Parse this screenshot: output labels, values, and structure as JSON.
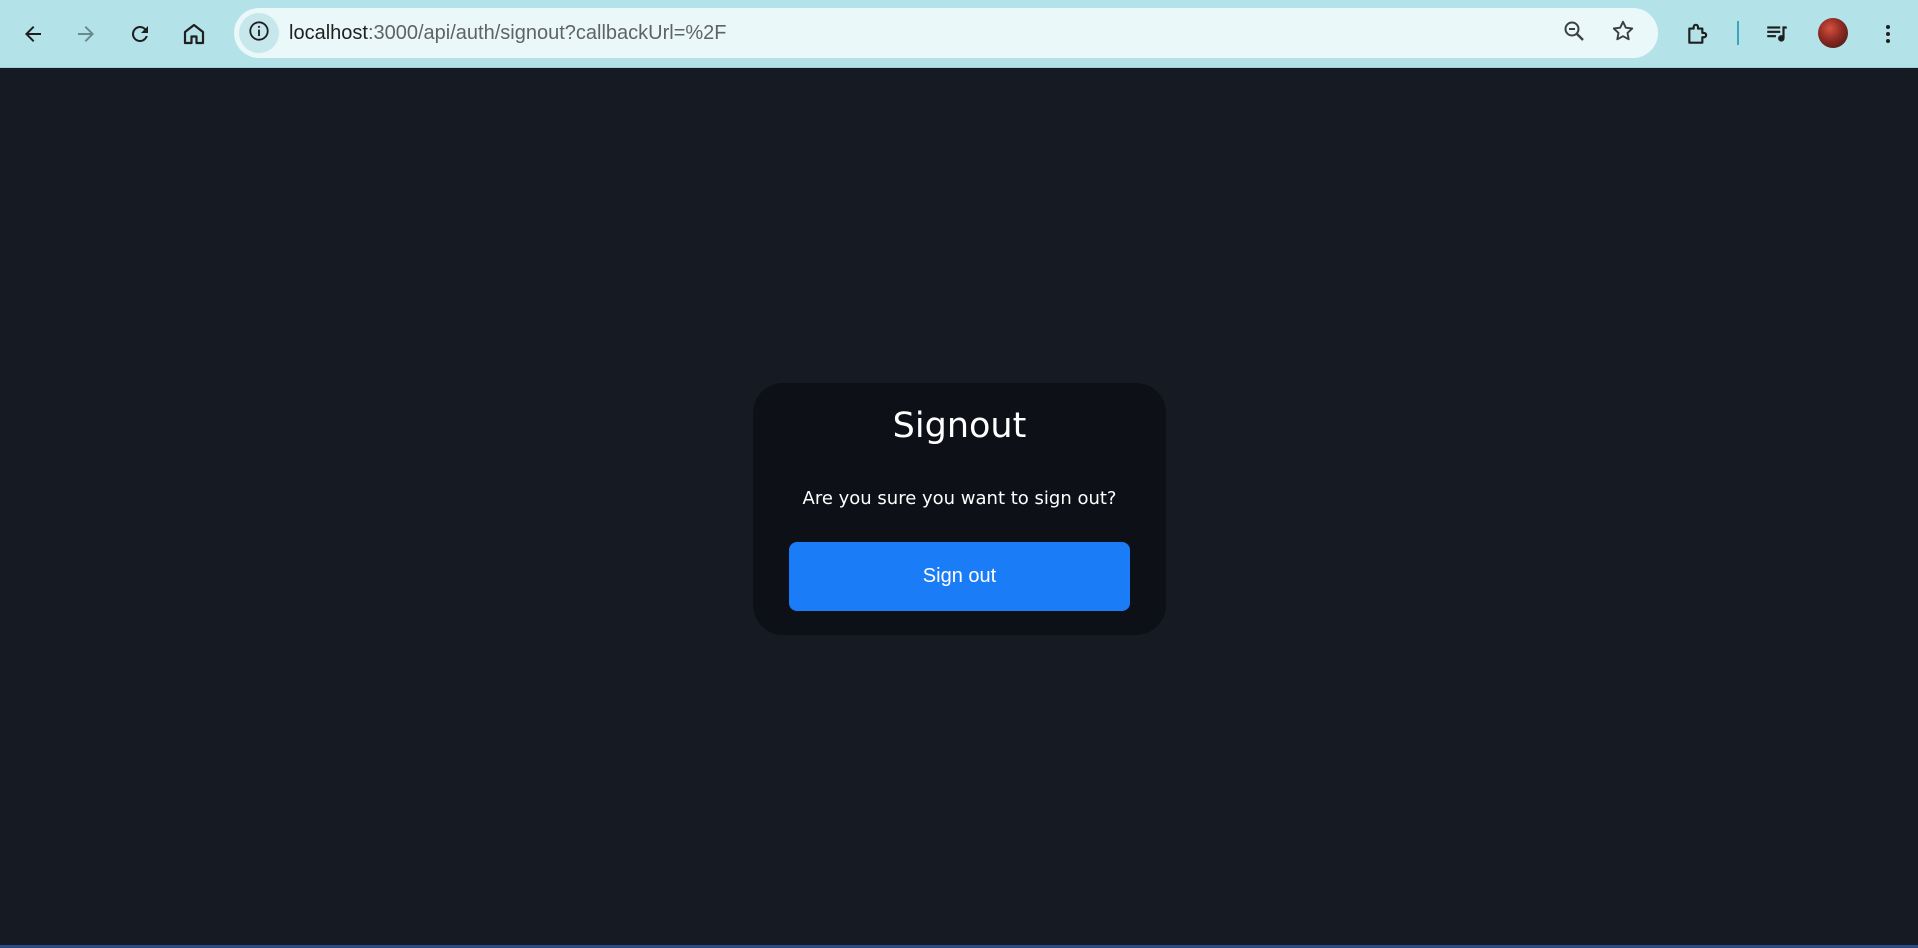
{
  "browser": {
    "url_host": "localhost",
    "url_path": ":3000/api/auth/signout?callbackUrl=%2F"
  },
  "icons": {
    "back": "arrow-left-icon",
    "forward": "arrow-right-icon",
    "reload": "reload-icon",
    "home": "home-icon",
    "site_info": "info-icon",
    "zoom": "zoom-out-icon",
    "bookmark": "star-icon",
    "extensions": "puzzle-icon",
    "media": "playlist-music-icon",
    "menu": "kebab-menu-icon"
  },
  "colors": {
    "toolbar": "#b3e3e9",
    "page_background": "#161a23",
    "card_background": "#0d1017",
    "button": "#1a7df7"
  },
  "signout": {
    "title": "Signout",
    "message": "Are you sure you want to sign out?",
    "button_label": "Sign out"
  }
}
